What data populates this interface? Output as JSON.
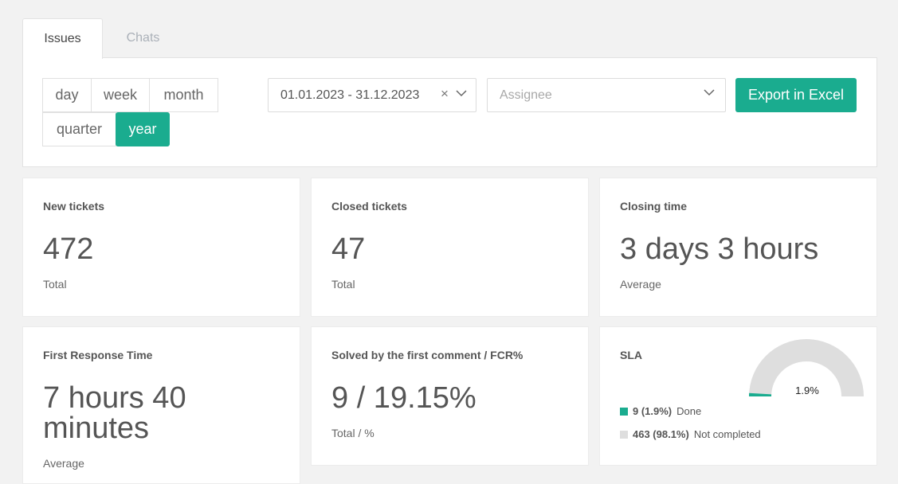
{
  "tabs": [
    {
      "label": "Issues",
      "active": true
    },
    {
      "label": "Chats",
      "active": false
    }
  ],
  "period": {
    "options": [
      "day",
      "week",
      "month",
      "quarter",
      "year"
    ],
    "selected": "year"
  },
  "filters": {
    "date_range": "01.01.2023 - 31.12.2023",
    "assignee_placeholder": "Assignee",
    "export_label": "Export in Excel"
  },
  "cards": {
    "new_tickets": {
      "title": "New tickets",
      "value": "472",
      "sub": "Total"
    },
    "closed_tickets": {
      "title": "Closed tickets",
      "value": "47",
      "sub": "Total"
    },
    "closing_time": {
      "title": "Closing time",
      "value": "3 days 3 hours",
      "sub": "Average"
    },
    "first_response": {
      "title": "First Response Time",
      "value_line1": "7 hours 40",
      "value_line2": "minutes",
      "sub": "Average"
    },
    "fcr": {
      "title": "Solved by the first comment / FCR%",
      "value": "9 / 19.15%",
      "sub": "Total / %"
    },
    "sla": {
      "title": "SLA",
      "gauge_label": "1.9%",
      "done_fraction": 0.019,
      "done": {
        "count": "9 (1.9%)",
        "label": "Done",
        "color": "#1aac8f"
      },
      "not_completed": {
        "count": "463 (98.1%)",
        "label": "Not completed",
        "color": "#dedede"
      }
    }
  },
  "colors": {
    "accent": "#1aac8f",
    "background": "#f2f2f2"
  }
}
